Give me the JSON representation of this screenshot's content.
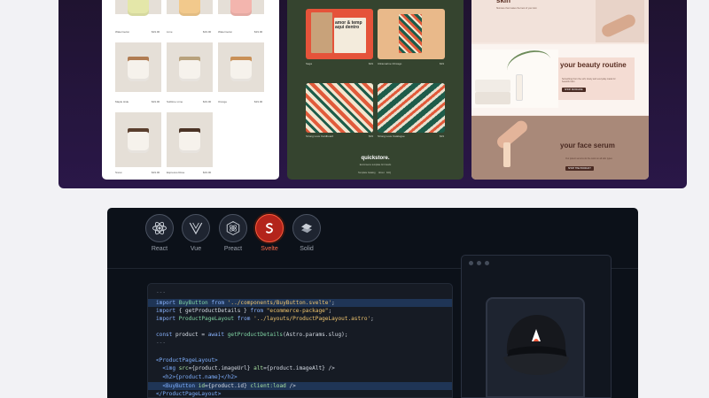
{
  "showcase": {
    "store": {
      "products": [
        {
          "name": "Watermelon",
          "price": "$19.00"
        },
        {
          "name": "Lime",
          "price": "$19.00"
        },
        {
          "name": "Watermelon",
          "price": "$19.00"
        },
        {
          "name": "Maple Hide",
          "price": "$19.00"
        },
        {
          "name": "Sublime Lime",
          "price": "$19.00"
        },
        {
          "name": "Orange",
          "price": "$19.00"
        },
        {
          "name": "Snow",
          "price": "$19.00"
        },
        {
          "name": "Espresso Rose",
          "price": "$19.00"
        }
      ],
      "colors": {
        "lime": "#e4e7a9",
        "peach": "#f2c98c",
        "rose": "#f3b5ae"
      }
    },
    "templates": {
      "tiles": [
        {
          "label": "Saga",
          "price": "$19"
        },
        {
          "label": "Ultramarine Chicago",
          "price": "$19"
        },
        {
          "label": "Strong Love Cardboard",
          "price": "$19"
        },
        {
          "label": "Strong Love Catalogue",
          "price": "$19"
        }
      ],
      "bag_text": "amor & temp aqui dentro",
      "brand": "quickstore.",
      "tagline": "Ecommerce template for brands",
      "footer_links": [
        "Template Catalog",
        "About",
        "FAQ"
      ]
    },
    "beauty": {
      "skin_word": "skin",
      "skin_text": "Skincare that makes the best of your skin",
      "heading1": "your beauty routine",
      "text1": "Something from the soft, lovely and everyday made for beautiful skin",
      "button1": "SHOP SKINCARE",
      "heading2": "your face serum",
      "text2": "Our potent serums do the work on all skin types",
      "button2": "SHOP THE PRODUCT"
    }
  },
  "frameworks": [
    {
      "name": "React",
      "icon": "react-icon",
      "active": false
    },
    {
      "name": "Vue",
      "icon": "vue-icon",
      "active": false
    },
    {
      "name": "Preact",
      "icon": "preact-icon",
      "active": false
    },
    {
      "name": "Svelte",
      "icon": "svelte-icon",
      "active": true
    },
    {
      "name": "Solid",
      "icon": "solid-icon",
      "active": false
    }
  ],
  "code": {
    "frontmatter_open": "---",
    "l1": [
      "import ",
      "BuyButton",
      " from ",
      "'../components/BuyButton.svelte'",
      ";"
    ],
    "l2": [
      "import ",
      "{ getProductDetails }",
      " from ",
      "\"ecommerce-package\"",
      ";"
    ],
    "l3": [
      "import ",
      "ProductPageLayout",
      " from ",
      "'../layouts/ProductPageLayout.astro'",
      ";"
    ],
    "l4": [
      "const ",
      "product",
      " = ",
      "await ",
      "getProductDetails",
      "(Astro.params.slug);"
    ],
    "frontmatter_close": "---",
    "l5": "<ProductPageLayout>",
    "l6": [
      "  <img ",
      "src",
      "={product.imageUrl} ",
      "alt",
      "={product.imageAlt} />"
    ],
    "l7": "  <h2>{product.name}</h2>",
    "l8": [
      "  <BuyButton ",
      "id",
      "={product.id} ",
      "client:load",
      " />"
    ],
    "l9": "</ProductPageLayout>"
  }
}
